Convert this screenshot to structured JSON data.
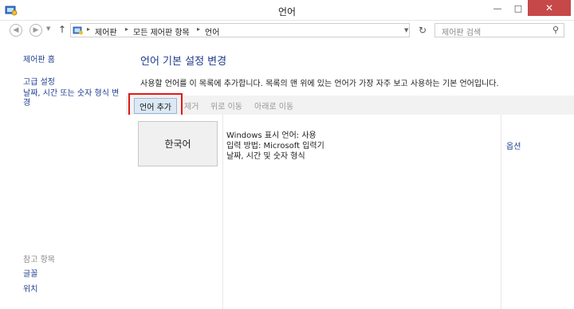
{
  "window": {
    "title": "언어",
    "controls": {
      "minimize": "—",
      "maximize": "□",
      "close": "✕"
    }
  },
  "nav": {
    "back_icon": "back-arrow-icon",
    "forward_icon": "forward-arrow-icon",
    "up_icon": "up-arrow-icon",
    "breadcrumb": [
      "제어판",
      "모든 제어판 항목",
      "언어"
    ],
    "search_placeholder": "제어판 검색"
  },
  "sidebar": {
    "home": "제어판 홈",
    "items": [
      "고급 설정",
      "날짜, 시간 또는 숫자 형식 변경"
    ],
    "see_also_title": "참고 항목",
    "see_also": [
      "글꼴",
      "위치"
    ]
  },
  "main": {
    "heading": "언어 기본 설정 변경",
    "description": "사용할 언어를 이 목록에 추가합니다. 목록의 맨 위에 있는 언어가 가장 자주 보고 사용하는 기본 언어입니다.",
    "toolbar": {
      "add": "언어 추가",
      "remove": "제거",
      "move_up": "위로 이동",
      "move_down": "아래로 이동"
    },
    "languages": [
      {
        "name": "한국어",
        "details": [
          "Windows 표시 언어: 사용",
          "입력 방법: Microsoft 입력기",
          "날짜, 시간 및 숫자 형식"
        ],
        "options": "옵션"
      }
    ]
  },
  "colors": {
    "link": "#1f3e8f",
    "heading": "#1e3a8c",
    "close_button": "#c74848",
    "highlight_box": "#e01818",
    "selected_button": "#dce9f5"
  }
}
